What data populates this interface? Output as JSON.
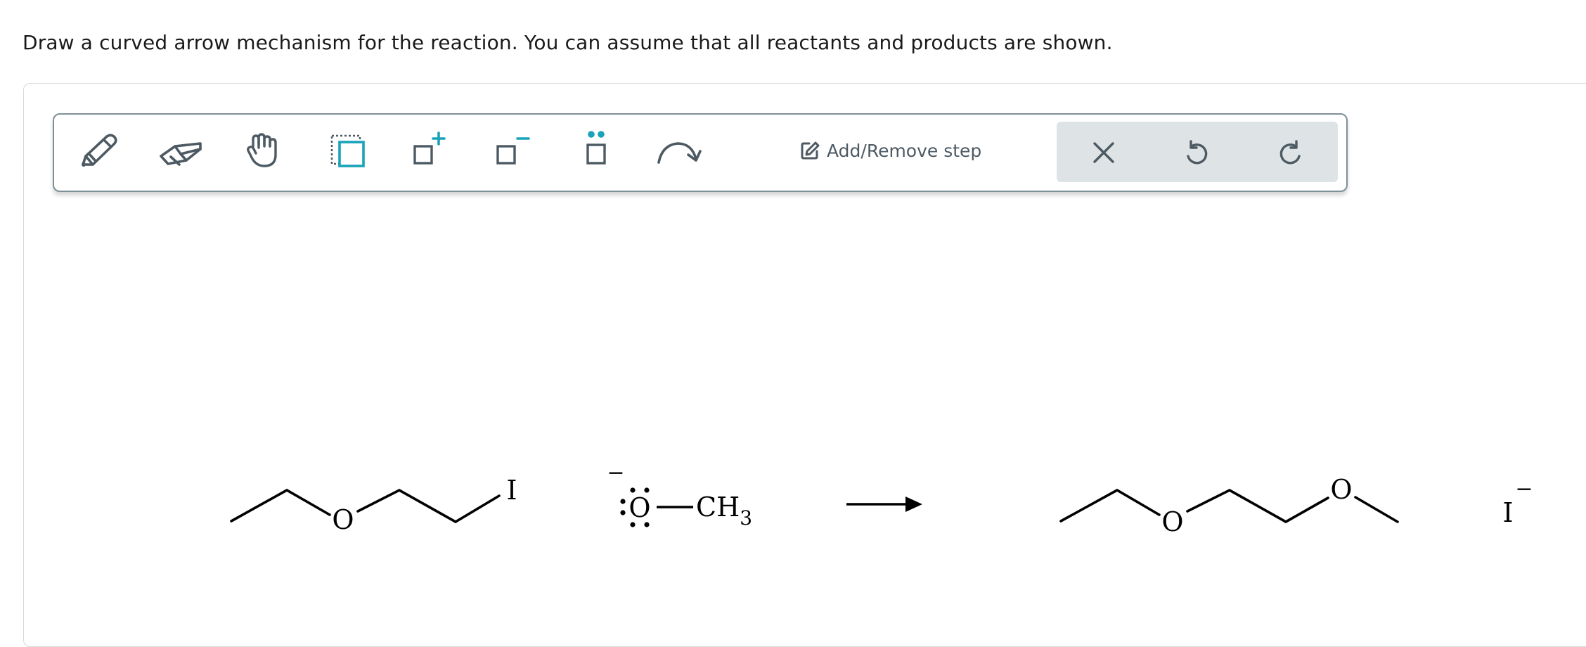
{
  "question": {
    "prompt": "Draw a curved arrow mechanism for the reaction. You can assume that all reactants and products are shown."
  },
  "toolbar": {
    "tools": [
      {
        "name": "draw-tool-button",
        "icon": "pencil-icon"
      },
      {
        "name": "erase-tool-button",
        "icon": "eraser-icon"
      },
      {
        "name": "move-tool-button",
        "icon": "hand-icon"
      },
      {
        "name": "select-tool-button",
        "icon": "selection-box-icon"
      },
      {
        "name": "add-charge-positive-button",
        "icon": "positive-charge-icon"
      },
      {
        "name": "add-charge-negative-button",
        "icon": "negative-charge-icon"
      },
      {
        "name": "add-lone-pair-button",
        "icon": "lone-pair-icon"
      },
      {
        "name": "curved-arrow-button",
        "icon": "curved-arrow-icon"
      }
    ],
    "step_label": "Add/Remove step",
    "actions": [
      {
        "name": "clear-button",
        "icon": "close-icon"
      },
      {
        "name": "undo-button",
        "icon": "undo-icon"
      },
      {
        "name": "redo-button",
        "icon": "redo-icon"
      }
    ],
    "accent_color": "#1aa3b8",
    "icon_color": "#4d5a63"
  },
  "reaction": {
    "reactant1": {
      "oxygen": "O",
      "iodine": "I"
    },
    "reactant2": {
      "charge": "−",
      "oxygen": "O",
      "methyl": "CH",
      "subscript": "3"
    },
    "product1": {
      "oxygen1": "O",
      "oxygen2": "O"
    },
    "product2": {
      "iodide": "I",
      "charge": "−"
    }
  }
}
